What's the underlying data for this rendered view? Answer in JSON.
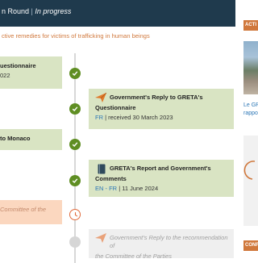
{
  "header": {
    "round_label": "n Round",
    "separator": "|",
    "status": "In progress"
  },
  "subtitle": "ctive remedies for victims of trafficking in human beings",
  "timeline": {
    "card1": {
      "title": "uestionnaire",
      "meta": "022"
    },
    "card2": {
      "title_line1": "Government's Reply to GRETA's",
      "title_line2": "Questionnaire",
      "lang": "FR",
      "meta": "| received 30 March 2023"
    },
    "card3": {
      "title": "to Monaco"
    },
    "card4": {
      "title_line1": "GRETA's Report and Government's",
      "title_line2": "Comments",
      "lang": "EN - FR",
      "meta": "| 11 June 2024"
    },
    "card5": {
      "title": "Committee of the"
    },
    "card6": {
      "title_line1": "Government's Reply to the recommendation of",
      "title_line2": "the Committee of the Parties"
    }
  },
  "right": {
    "heading": "ACTI",
    "text_line1": "Le GR",
    "text_line2": "rappo",
    "heading2": "CONF"
  },
  "colors": {
    "header_bg": "#1f3a4d",
    "accent_orange": "#d0783c",
    "done_green": "#5f8e23",
    "card_green": "#d9e4c3",
    "card_orange": "#fbd7bf",
    "link_blue": "#2c77b6"
  },
  "icons": {
    "done": "check-circle-icon",
    "pending": "clock-icon",
    "future": "circle-icon",
    "reply": "paper-plane-icon",
    "report": "book-icon"
  }
}
